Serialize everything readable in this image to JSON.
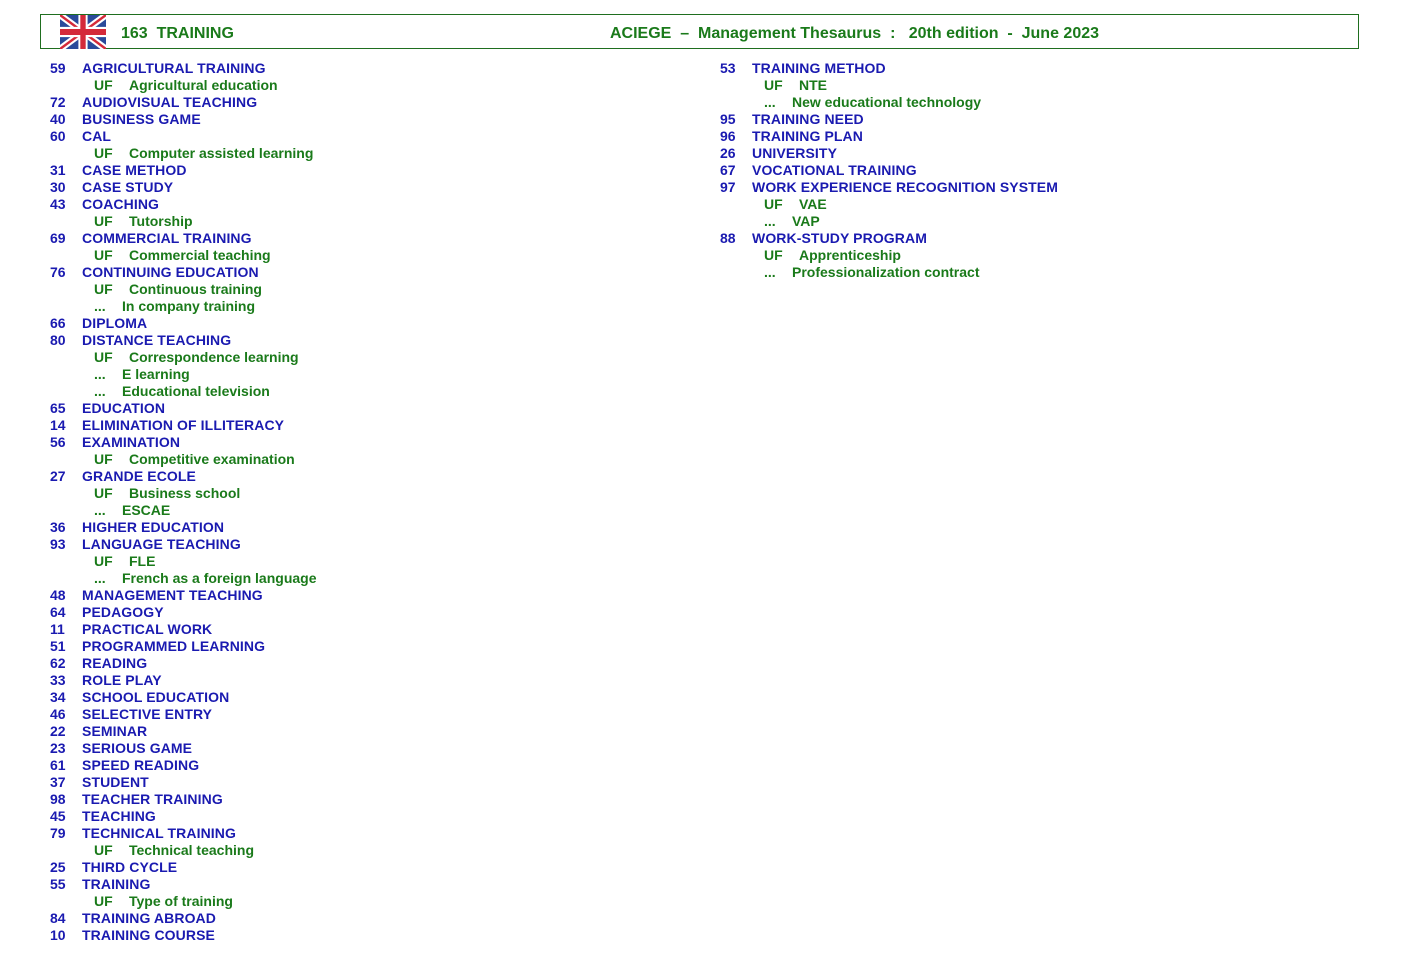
{
  "header": {
    "flag_icon": "uk-flag-icon",
    "section": "163  TRAINING",
    "title": "ACIEGE  –  Management Thesaurus  :   20th edition  -  June 2023"
  },
  "colors": {
    "term": "#1a1ab0",
    "related": "#1a7a1a",
    "border": "#1f6e1f"
  },
  "columns": [
    {
      "rows": [
        {
          "type": "term",
          "num": "59",
          "label": "AGRICULTURAL TRAINING"
        },
        {
          "type": "uf",
          "tag": "UF",
          "label": "Agricultural education"
        },
        {
          "type": "term",
          "num": "72",
          "label": "AUDIOVISUAL TEACHING"
        },
        {
          "type": "term",
          "num": "40",
          "label": "BUSINESS GAME"
        },
        {
          "type": "term",
          "num": "60",
          "label": "CAL"
        },
        {
          "type": "uf",
          "tag": "UF",
          "label": "Computer assisted learning"
        },
        {
          "type": "term",
          "num": "31",
          "label": "CASE METHOD"
        },
        {
          "type": "term",
          "num": "30",
          "label": "CASE STUDY"
        },
        {
          "type": "term",
          "num": "43",
          "label": "COACHING"
        },
        {
          "type": "uf",
          "tag": "UF",
          "label": "Tutorship"
        },
        {
          "type": "term",
          "num": "69",
          "label": "COMMERCIAL TRAINING"
        },
        {
          "type": "uf",
          "tag": "UF",
          "label": "Commercial teaching"
        },
        {
          "type": "term",
          "num": "76",
          "label": "CONTINUING EDUCATION"
        },
        {
          "type": "uf",
          "tag": "UF",
          "label": "Continuous training"
        },
        {
          "type": "rel",
          "tag": "...",
          "label": "In company training"
        },
        {
          "type": "term",
          "num": "66",
          "label": "DIPLOMA"
        },
        {
          "type": "term",
          "num": "80",
          "label": "DISTANCE TEACHING"
        },
        {
          "type": "uf",
          "tag": "UF",
          "label": "Correspondence learning"
        },
        {
          "type": "rel",
          "tag": "...",
          "label": "E learning"
        },
        {
          "type": "rel",
          "tag": "...",
          "label": "Educational television"
        },
        {
          "type": "term",
          "num": "65",
          "label": "EDUCATION"
        },
        {
          "type": "term",
          "num": "14",
          "label": "ELIMINATION OF ILLITERACY"
        },
        {
          "type": "term",
          "num": "56",
          "label": "EXAMINATION"
        },
        {
          "type": "uf",
          "tag": "UF",
          "label": "Competitive examination"
        },
        {
          "type": "term",
          "num": "27",
          "label": "GRANDE ECOLE"
        },
        {
          "type": "uf",
          "tag": "UF",
          "label": "Business school"
        },
        {
          "type": "rel",
          "tag": "...",
          "label": "ESCAE"
        },
        {
          "type": "term",
          "num": "36",
          "label": "HIGHER EDUCATION"
        },
        {
          "type": "term",
          "num": "93",
          "label": "LANGUAGE TEACHING"
        },
        {
          "type": "uf",
          "tag": "UF",
          "label": "FLE"
        },
        {
          "type": "rel",
          "tag": "...",
          "label": "French as a foreign language"
        },
        {
          "type": "term",
          "num": "48",
          "label": "MANAGEMENT TEACHING"
        },
        {
          "type": "term",
          "num": "64",
          "label": "PEDAGOGY"
        },
        {
          "type": "term",
          "num": "11",
          "label": "PRACTICAL WORK"
        },
        {
          "type": "term",
          "num": "51",
          "label": "PROGRAMMED LEARNING"
        },
        {
          "type": "term",
          "num": "62",
          "label": "READING"
        },
        {
          "type": "term",
          "num": "33",
          "label": "ROLE PLAY"
        },
        {
          "type": "term",
          "num": "34",
          "label": "SCHOOL EDUCATION"
        },
        {
          "type": "term",
          "num": "46",
          "label": "SELECTIVE ENTRY"
        },
        {
          "type": "term",
          "num": "22",
          "label": "SEMINAR"
        },
        {
          "type": "term",
          "num": "23",
          "label": "SERIOUS GAME"
        },
        {
          "type": "term",
          "num": "61",
          "label": "SPEED READING"
        },
        {
          "type": "term",
          "num": "37",
          "label": "STUDENT"
        },
        {
          "type": "term",
          "num": "98",
          "label": "TEACHER TRAINING"
        },
        {
          "type": "term",
          "num": "45",
          "label": "TEACHING"
        },
        {
          "type": "term",
          "num": "79",
          "label": "TECHNICAL TRAINING"
        },
        {
          "type": "uf",
          "tag": "UF",
          "label": "Technical teaching"
        },
        {
          "type": "term",
          "num": "25",
          "label": "THIRD CYCLE"
        },
        {
          "type": "term",
          "num": "55",
          "label": "TRAINING"
        },
        {
          "type": "uf",
          "tag": "UF",
          "label": "Type of training"
        },
        {
          "type": "term",
          "num": "84",
          "label": "TRAINING ABROAD"
        },
        {
          "type": "term",
          "num": "10",
          "label": "TRAINING COURSE"
        }
      ]
    },
    {
      "rows": [
        {
          "type": "term",
          "num": "53",
          "label": "TRAINING METHOD"
        },
        {
          "type": "uf",
          "tag": "UF",
          "label": "NTE"
        },
        {
          "type": "rel",
          "tag": "...",
          "label": "New educational technology"
        },
        {
          "type": "term",
          "num": "95",
          "label": "TRAINING NEED"
        },
        {
          "type": "term",
          "num": "96",
          "label": "TRAINING PLAN"
        },
        {
          "type": "term",
          "num": "26",
          "label": "UNIVERSITY"
        },
        {
          "type": "term",
          "num": "67",
          "label": "VOCATIONAL TRAINING"
        },
        {
          "type": "term",
          "num": "97",
          "label": "WORK EXPERIENCE RECOGNITION SYSTEM"
        },
        {
          "type": "uf",
          "tag": "UF",
          "label": "VAE"
        },
        {
          "type": "rel",
          "tag": "...",
          "label": "VAP"
        },
        {
          "type": "term",
          "num": "88",
          "label": "WORK-STUDY PROGRAM"
        },
        {
          "type": "uf",
          "tag": "UF",
          "label": "Apprenticeship"
        },
        {
          "type": "rel",
          "tag": "...",
          "label": "Professionalization contract"
        }
      ]
    }
  ]
}
